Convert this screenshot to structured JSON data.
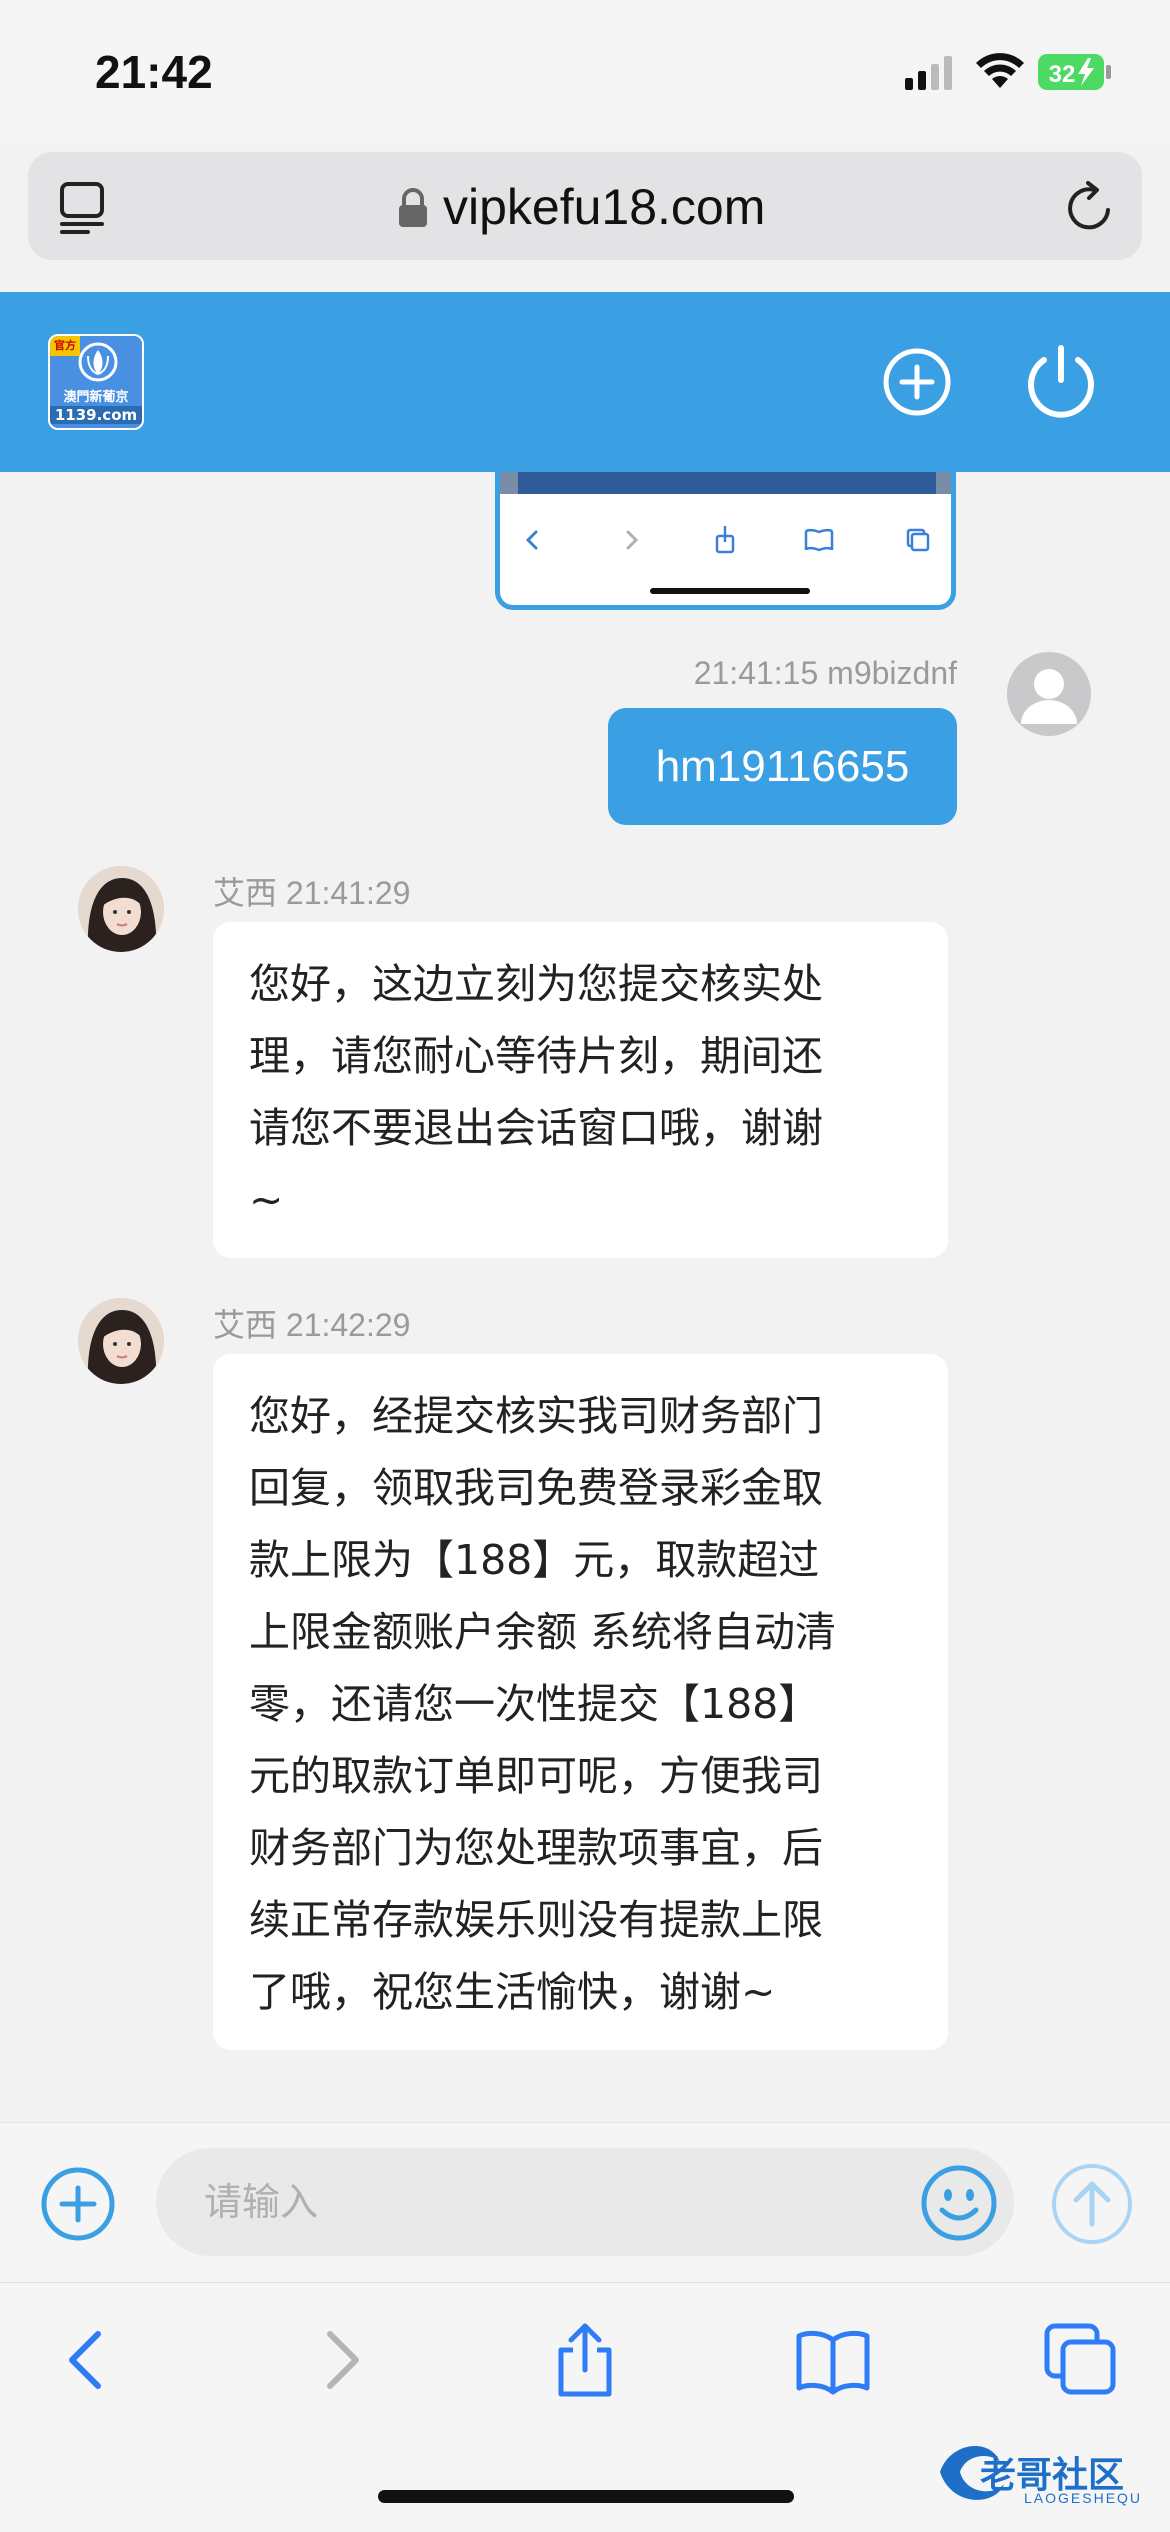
{
  "status_bar": {
    "time": "21:42",
    "battery": "32"
  },
  "url_bar": {
    "url": "vipkefu18.com"
  },
  "app_header": {
    "logo_badge": "官方",
    "logo_name": "澳門新葡京",
    "logo_domain": "1139.com",
    "color": "#3b9fe4"
  },
  "messages": {
    "user": {
      "meta": "21:41:15 m9bizdnf",
      "text": "hm19116655"
    },
    "agent1": {
      "meta": "艾西 21:41:29",
      "lines": [
        "您好，这边立刻为您提交核实处",
        "理，请您耐心等待片刻，期间还",
        "请您不要退出会话窗口哦，谢谢",
        "~"
      ]
    },
    "agent2": {
      "meta": "艾西 21:42:29",
      "lines": [
        "您好，经提交核实我司财务部门",
        "回复，领取我司免费登录彩金取",
        "款上限为【188】元，取款超过",
        "上限金额账户余额 系统将自动清",
        "零，还请您一次性提交【188】",
        "元的取款订单即可呢，方便我司",
        "财务部门为您处理款项事宜，后",
        "续正常存款娱乐则没有提款上限",
        "了哦，祝您生活愉快，谢谢~"
      ]
    }
  },
  "input": {
    "placeholder": "请输入"
  },
  "watermark": {
    "text": "老哥社区",
    "sub": "LAOGESHEQU"
  },
  "icons": {
    "tabs": "tabs-icon",
    "lock": "lock-icon",
    "reload": "reload-icon",
    "add": "plus-circle-icon",
    "power": "power-icon",
    "emoji": "smiley-icon",
    "send": "arrow-up-circle-icon",
    "back": "chevron-left-icon",
    "forward": "chevron-right-icon",
    "share": "share-icon",
    "bookmarks": "book-icon",
    "tab_switcher": "tabs-switcher-icon"
  }
}
